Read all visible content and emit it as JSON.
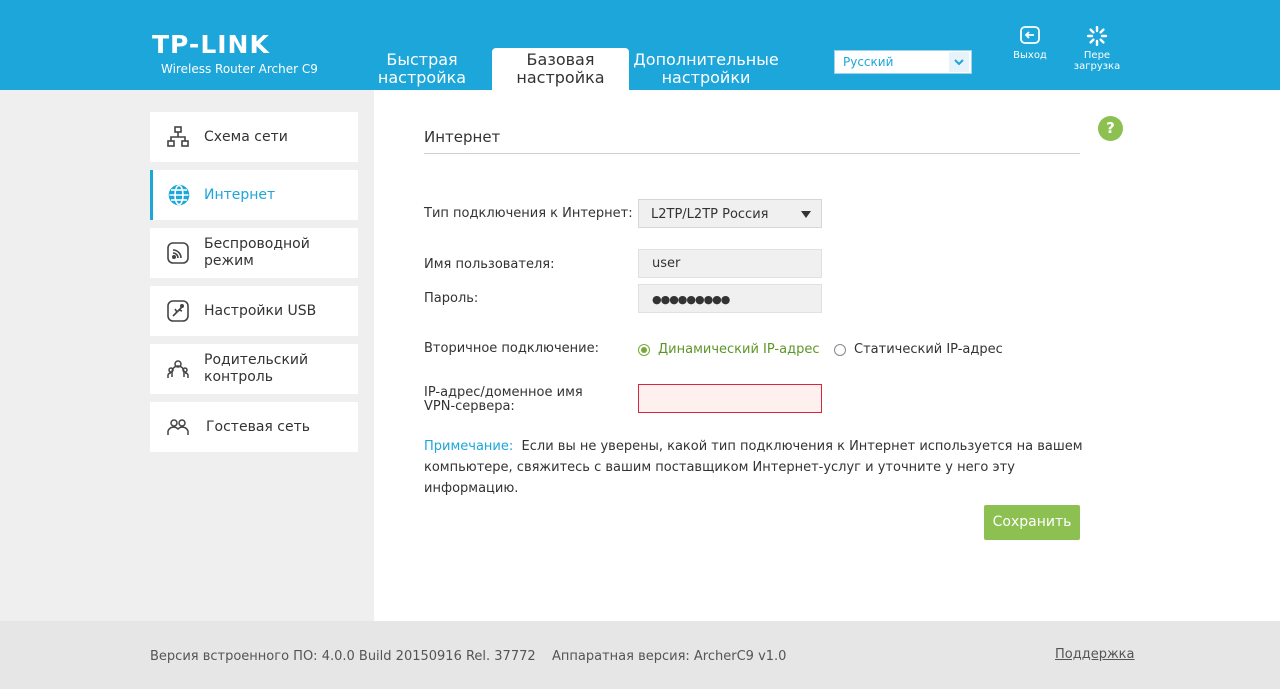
{
  "header": {
    "logo": "TP-LINK",
    "model": "Wireless Router Archer C9",
    "tabs": [
      {
        "line1": "Быстрая",
        "line2": "настройка"
      },
      {
        "line1": "Базовая",
        "line2": "настройка"
      },
      {
        "line1": "Дополнительные",
        "line2": "настройки"
      }
    ],
    "language": "Русский",
    "logout_label": "Выход",
    "reboot_line1": "Пере",
    "reboot_line2": "загрузка"
  },
  "sidebar": {
    "items": [
      {
        "label": "Схема сети",
        "icon": "network-map-icon"
      },
      {
        "label": "Интернет",
        "icon": "globe-icon",
        "active": true
      },
      {
        "label": "Беспроводной режим",
        "icon": "wireless-icon"
      },
      {
        "label": "Настройки USB",
        "icon": "usb-icon"
      },
      {
        "label": "Родительский контроль",
        "icon": "parental-control-icon"
      },
      {
        "label": "Гостевая сеть",
        "icon": "guest-network-icon"
      }
    ]
  },
  "main": {
    "title": "Интернет",
    "help": "?",
    "connection_type_label": "Тип подключения к Интернет:",
    "connection_type_value": "L2TP/L2TP Россия",
    "username_label": "Имя пользователя:",
    "username_value": "user",
    "password_label": "Пароль:",
    "password_value": "●●●●●●●●●",
    "secondary_label": "Вторичное подключение:",
    "secondary_options": [
      "Динамический IP-адрес",
      "Статический IP-адрес"
    ],
    "secondary_selected": "Динамический IP-адрес",
    "vpn_label_line1": "IP-адрес/доменное имя",
    "vpn_label_line2": "VPN-сервера:",
    "vpn_value": "",
    "note_label": "Примечание:",
    "note_text": "Если вы не уверены, какой тип подключения к Интернет используется на вашем компьютере, свяжитесь с вашим поставщиком Интернет-услуг и уточните у него эту информацию.",
    "save_label": "Сохранить"
  },
  "footer": {
    "firmware": "Версия встроенного ПО: 4.0.0 Build 20150916 Rel. 37772",
    "hardware": "Аппаратная версия: ArcherC9 v1.0",
    "support": "Поддержка"
  },
  "colors": {
    "brand": "#1ca6d9",
    "accent_green": "#8cc152",
    "error_red": "#d7263d"
  }
}
